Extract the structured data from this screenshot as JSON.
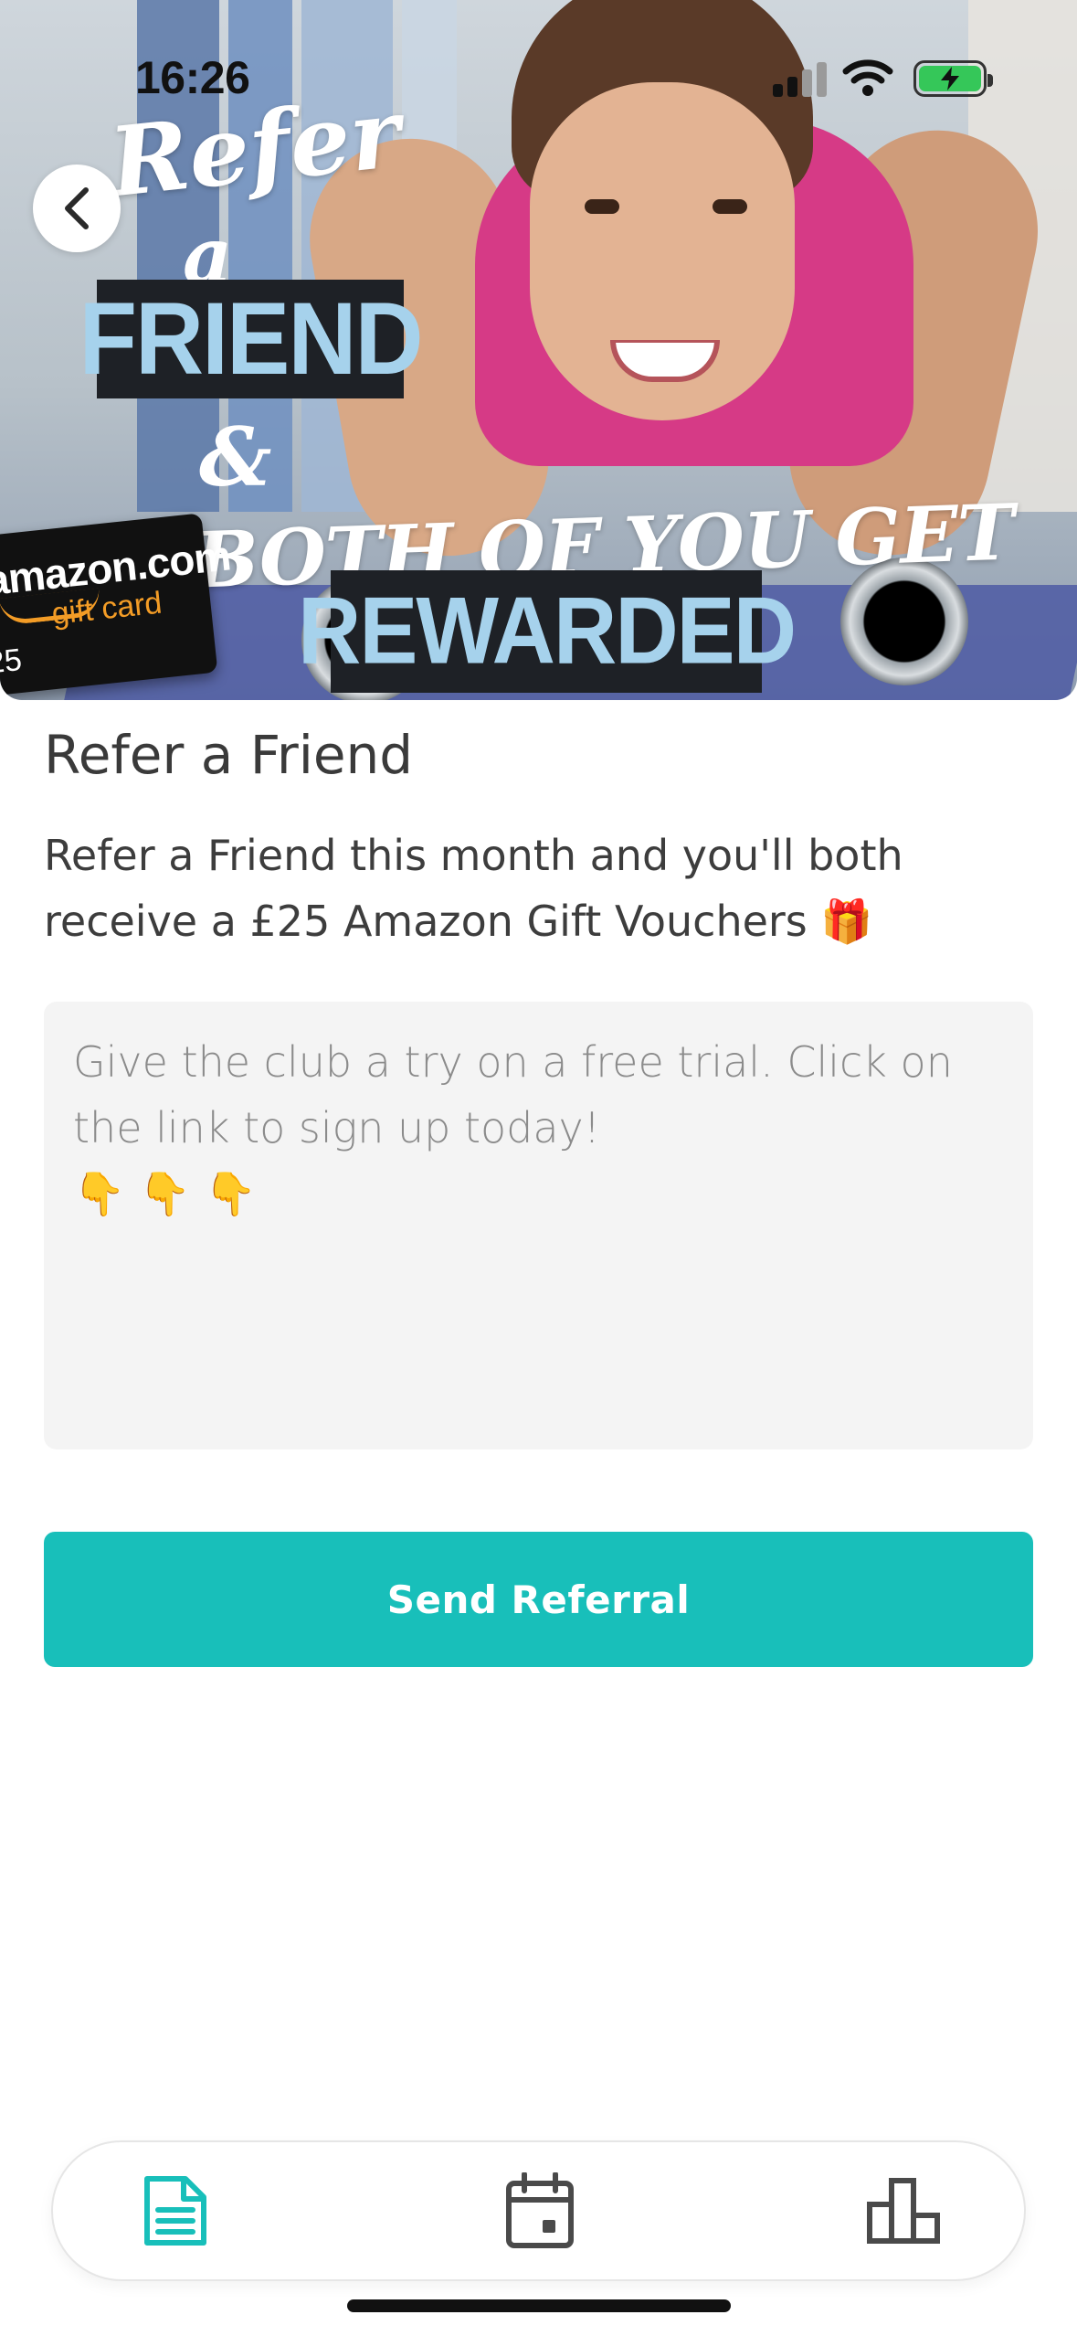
{
  "status_bar": {
    "time": "16:26",
    "battery_charging": true,
    "battery_color": "#35c759"
  },
  "hero": {
    "promo_lines": [
      "Refer",
      "a",
      "FRIEND",
      "&",
      "BOTH OF YOU GET",
      "REWARDED"
    ],
    "gift_card": {
      "brand": "amazon.com",
      "subtitle": "gift card",
      "amount_fragment": "25"
    }
  },
  "back_button": {
    "icon": "chevron-left-icon"
  },
  "main": {
    "title": "Refer a Friend",
    "description": "Refer a Friend this month and you'll both receive a £25 Amazon Gift Vouchers 🎁",
    "message": "Give the club a try on a free trial. Click on the link to sign up today!\n👇 👇 👇",
    "send_button_label": "Send Referral"
  },
  "tab_bar": {
    "items": [
      {
        "icon": "document-icon",
        "active": true
      },
      {
        "icon": "calendar-icon",
        "active": false
      },
      {
        "icon": "bar-chart-icon",
        "active": false
      }
    ]
  },
  "colors": {
    "accent": "#18bfba",
    "text": "#3d3d3d",
    "placeholder": "#8b8b8b",
    "input_bg": "#f4f4f4",
    "promo_blue": "#a6d2ec",
    "promo_box": "#1e2126",
    "icon_inactive": "#4a4a4a"
  }
}
